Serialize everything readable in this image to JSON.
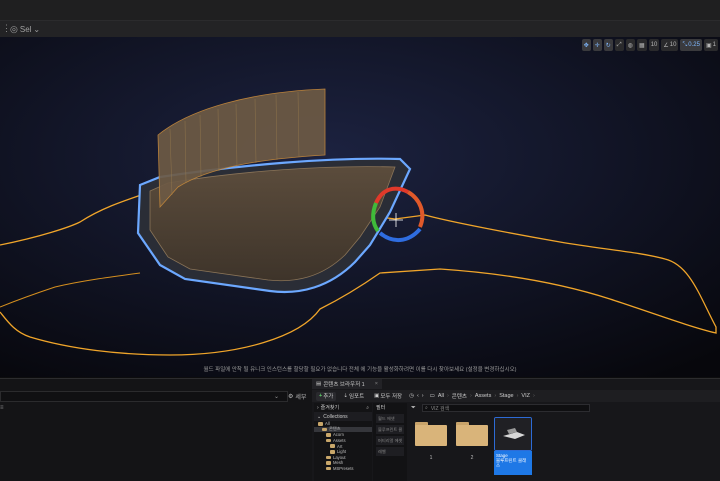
{
  "toolbar": {
    "mode_label": "Sel"
  },
  "viewport_toolbar": {
    "buttons": [
      {
        "icon": "select-icon",
        "active": true
      },
      {
        "icon": "move-icon",
        "active": true
      },
      {
        "icon": "rotate-icon",
        "active": true
      },
      {
        "icon": "scale-icon",
        "active": false
      },
      {
        "icon": "globe-icon",
        "active": false
      },
      {
        "icon": "snap-grid-icon",
        "active": false
      },
      {
        "icon": "grid-snap-value",
        "text": "10",
        "active": false
      },
      {
        "icon": "angle-snap-icon",
        "text": "10",
        "active": false
      },
      {
        "icon": "scale-snap-icon",
        "text": "0.25",
        "active": true
      },
      {
        "icon": "camera-speed-icon",
        "text": "1",
        "active": false
      }
    ]
  },
  "viewport": {
    "status_message": "월드 파일에 안착 될 유니크 인스턴스를 할당할 필요가 없습니다 전체 에 기능을 활성화하려면 이를 다시 찾아보세요 (설정을 변경하십시오)"
  },
  "details_panel": {
    "search_placeholder": "",
    "details_label": "세부",
    "selection_hint": ""
  },
  "content_browser": {
    "tab_label": "콘텐츠 브라우저 1",
    "add_label": "추가",
    "import_label": "임포트",
    "save_all_label": "모두 저장",
    "breadcrumbs": [
      "All",
      "콘텐츠",
      "Assets",
      "Stage",
      "VIZ"
    ],
    "favorites_label": "즐겨찾기",
    "filter_label": "필터",
    "collections_label": "Collections",
    "filters": [
      "월드 에셋",
      "블루프린트 클",
      "머티리얼 에셋",
      "레벨"
    ],
    "search_placeholder": "VIZ 검색",
    "tree": [
      {
        "label": "All",
        "depth": 0
      },
      {
        "label": "콘텐츠",
        "depth": 1,
        "selected": true
      },
      {
        "label": "Acorn",
        "depth": 2
      },
      {
        "label": "Assets",
        "depth": 2
      },
      {
        "label": "Art",
        "depth": 3
      },
      {
        "label": "Light",
        "depth": 3
      },
      {
        "label": "Layout",
        "depth": 2
      },
      {
        "label": "Mesh",
        "depth": 2
      },
      {
        "label": "MSPresets",
        "depth": 2
      }
    ],
    "items": [
      {
        "label": "1",
        "kind": "folder"
      },
      {
        "label": "2",
        "kind": "folder"
      },
      {
        "label": "Stage",
        "kind": "asset",
        "sub": "블루프린트 클래스"
      }
    ]
  },
  "colors": {
    "accent": "#1e78e6",
    "selection_outline": "#ffa400",
    "viewport_bg": "#0b0b12"
  }
}
